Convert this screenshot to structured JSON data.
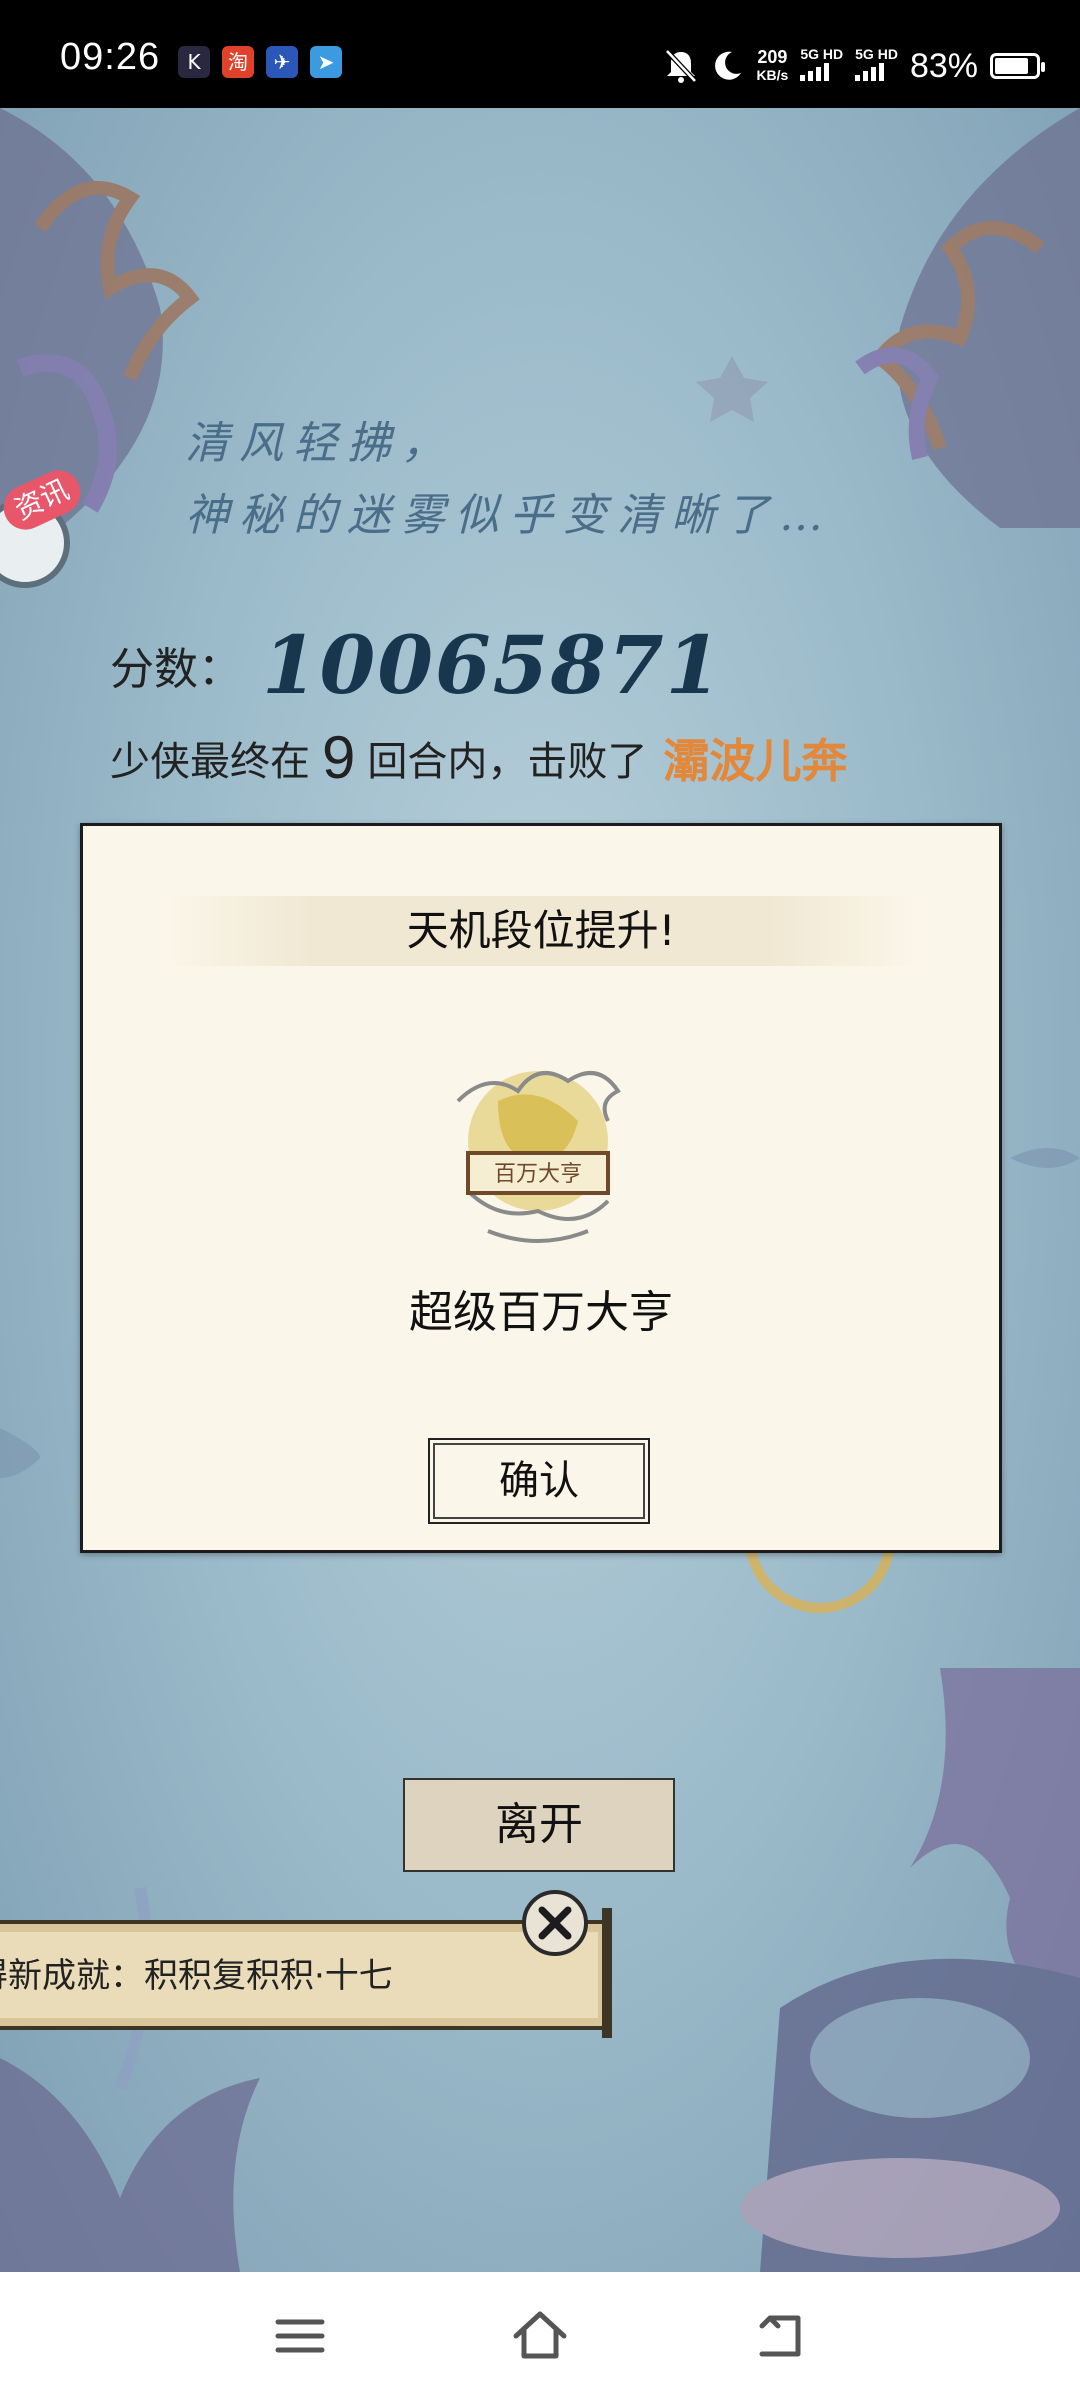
{
  "status_bar": {
    "time": "09:26",
    "app_icons": [
      "K",
      "淘",
      "✈",
      "➤"
    ],
    "net_speed_value": "209",
    "net_speed_unit": "KB/s",
    "sim1_label": "5G HD",
    "sim2_label": "5G HD",
    "battery_percent": "83%",
    "battery_level": 0.83
  },
  "game": {
    "poem_line1": "清风轻拂，",
    "poem_line2": "神秘的迷雾似乎变清晰了…",
    "news_badge": "资讯",
    "score_label": "分数：",
    "score_value": "10065871",
    "result_prefix": "少侠最终在",
    "result_rounds": "9",
    "result_middle": "回合内，击败了",
    "boss_name": "灞波儿奔",
    "leave_button": "离开",
    "achievement_text": "获得新成就：积积复积积·十七",
    "colors": {
      "boss": "#e2883a",
      "water": "#98b8c8"
    }
  },
  "dialog": {
    "title": "天机段位提升!",
    "rank_badge_text": "百万大亨",
    "rank_name": "超级百万大亨",
    "confirm_button": "确认"
  },
  "nav": {
    "icons": [
      "menu-icon",
      "home-icon",
      "back-icon"
    ]
  }
}
